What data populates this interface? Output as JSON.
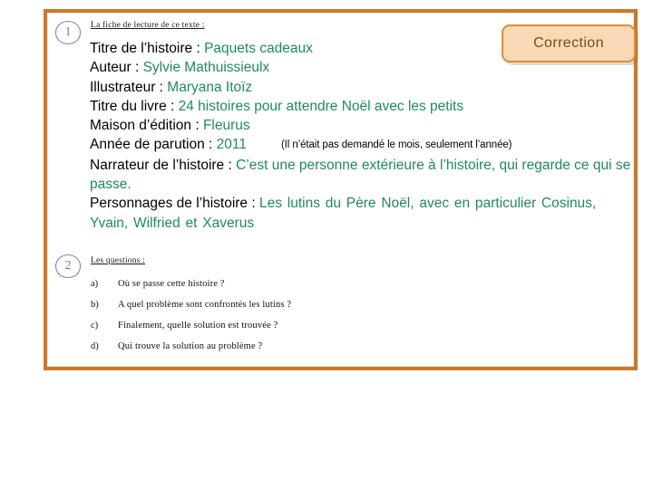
{
  "slide": {
    "frame_color": "#c87a2b",
    "background": "#ffffff"
  },
  "correction_badge": {
    "label": "Correction",
    "fill": "#fad9b6",
    "border": "#e08b35",
    "text_color": "#7a4a19"
  },
  "section_one": {
    "number": "1",
    "heading": "La fiche de lecture de ce texte :",
    "answer_color": "#1f8a5e",
    "fields": [
      {
        "label": "Titre de l’histoire : ",
        "value": "Paquets cadeaux"
      },
      {
        "label": "Auteur : ",
        "value": "Sylvie Mathuissieulx"
      },
      {
        "label": "Illustrateur : ",
        "value": "Maryana Itoïz"
      },
      {
        "label": "Titre du livre : ",
        "value": "24 histoires pour attendre Noël avec les petits"
      },
      {
        "label": "Maison d’édition : ",
        "value": "Fleurus"
      },
      {
        "label": "Année de parution : ",
        "value": "2011",
        "note": "(Il n’était pas demandé le mois, seulement l’année)"
      },
      {
        "label": "Narrateur de l’histoire : ",
        "value": "C’est une personne extérieure à l’histoire, qui regarde ce qui se passe."
      },
      {
        "label": "Personnages de l’histoire : ",
        "value": "Les lutins du Père Noël, avec en particulier Cosinus, Yvain, Wilfried et Xaverus"
      }
    ]
  },
  "section_two": {
    "number": "2",
    "heading": "Les questions :",
    "questions": [
      {
        "marker": "a)",
        "text": "Où se passe cette histoire ?"
      },
      {
        "marker": "b)",
        "text": "A quel problème sont confrontés les lutins ?"
      },
      {
        "marker": "c)",
        "text": "Finalement, quelle solution est trouvée ?"
      },
      {
        "marker": "d)",
        "text": "Qui trouve la solution au problème ?"
      }
    ]
  }
}
